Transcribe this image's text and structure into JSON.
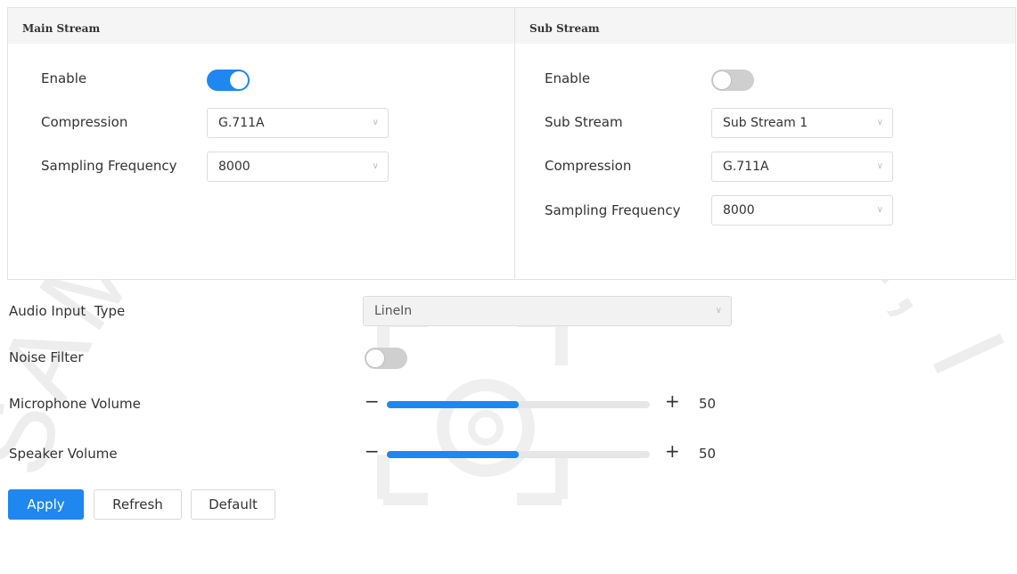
{
  "main_stream": {
    "title": "Main Stream",
    "enable_label": "Enable",
    "enabled": true,
    "compression_label": "Compression",
    "compression_value": "G.711A",
    "sampling_label": "Sampling Frequency",
    "sampling_value": "8000"
  },
  "sub_stream": {
    "title": "Sub Stream",
    "enable_label": "Enable",
    "enabled": false,
    "sub_stream_label": "Sub Stream",
    "sub_stream_value": "Sub Stream 1",
    "compression_label": "Compression",
    "compression_value": "G.711A",
    "sampling_label": "Sampling Frequency",
    "sampling_value": "8000"
  },
  "audio": {
    "input_type_label": "Audio Input  Type",
    "input_type_value": "LineIn",
    "noise_filter_label": "Noise Filter",
    "noise_filter_enabled": false,
    "mic_volume_label": "Microphone Volume",
    "mic_volume_value": "50",
    "speaker_volume_label": "Speaker Volume",
    "speaker_volume_value": "50",
    "minus": "−",
    "plus": "+"
  },
  "buttons": {
    "apply": "Apply",
    "refresh": "Refresh",
    "default": "Default"
  },
  "watermark_text": "SAM DISTRIBUTION, I",
  "colors": {
    "accent": "#1e87f0",
    "toggle_off": "#cfcfcf"
  }
}
